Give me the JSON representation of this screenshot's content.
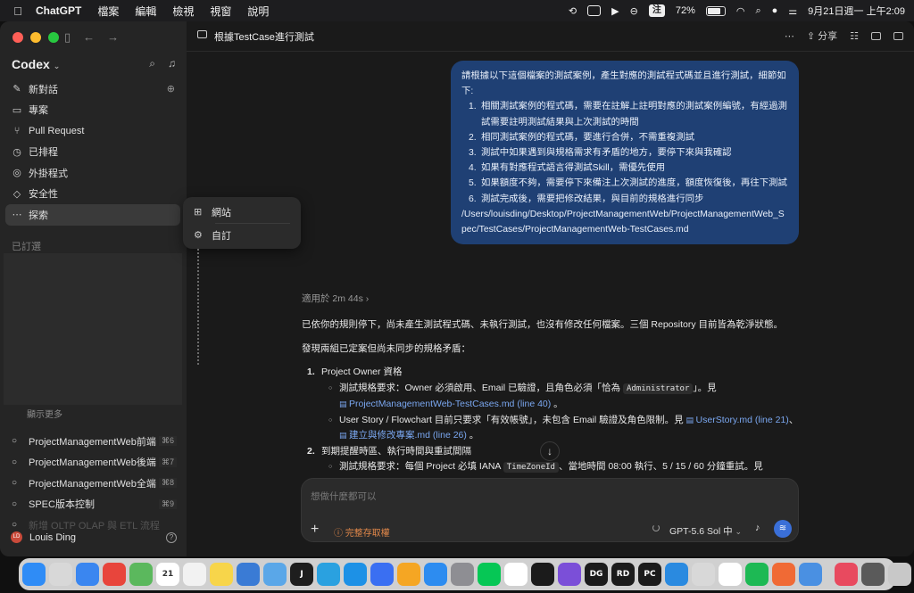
{
  "menubar": {
    "app": "ChatGPT",
    "menus": [
      "檔案",
      "編輯",
      "檢視",
      "視窗",
      "說明"
    ],
    "input_method": "注",
    "battery": "72%",
    "datetime": "9月21日週一 上午2:09"
  },
  "sidebar": {
    "brand": "Codex",
    "nav": [
      {
        "icon": "edit-icon",
        "glyph": "✎",
        "label": "新對話"
      },
      {
        "icon": "folder-icon",
        "glyph": "▭",
        "label": "專案"
      },
      {
        "icon": "pull-request-icon",
        "glyph": "⑂",
        "label": "Pull Request"
      },
      {
        "icon": "clock-icon",
        "glyph": "◷",
        "label": "已排程"
      },
      {
        "icon": "plugin-icon",
        "glyph": "◎",
        "label": "外掛程式"
      },
      {
        "icon": "shield-icon",
        "glyph": "◇",
        "label": "安全性"
      },
      {
        "icon": "more-icon",
        "glyph": "⋯",
        "label": "探索"
      }
    ],
    "pinned_label": "已訂選",
    "show_more": "顯示更多",
    "threads": [
      {
        "label": "ProjectManagementWeb前端",
        "shortcut": "⌘6"
      },
      {
        "label": "ProjectManagementWeb後端",
        "shortcut": "⌘7"
      },
      {
        "label": "ProjectManagementWeb全端",
        "shortcut": "⌘8"
      },
      {
        "label": "SPEC版本控制",
        "shortcut": "⌘9"
      },
      {
        "label": "新增 OLTP OLAP 與 ETL 流程",
        "shortcut": ""
      }
    ],
    "user": {
      "initials": "LD",
      "name": "Louis Ding"
    }
  },
  "popup": {
    "items": [
      {
        "icon": "website-icon",
        "glyph": "⊞",
        "label": "網站"
      },
      {
        "icon": "customize-icon",
        "glyph": "⚙",
        "label": "自訂"
      }
    ]
  },
  "main": {
    "title": "根據TestCase進行測試",
    "share_label": "分享",
    "user_message": {
      "intro": "請根據以下這個檔案的測試案例，產生對應的測試程式碼並且進行測試，細節如下:",
      "items": [
        {
          "n": "1.",
          "text": "相關測試案例的程式碼，需要在註解上註明對應的測試案例編號，有經過測試需要註明測試結果與上次測試的時間"
        },
        {
          "n": "2.",
          "text": "相同測試案例的程式碼，要進行合併，不需重複測試"
        },
        {
          "n": "3.",
          "text": "測試中如果遇到與規格需求有矛盾的地方，要停下來與我確認"
        },
        {
          "n": "4.",
          "text": "如果有對應程式語言得測試Skill，需優先使用"
        },
        {
          "n": "5.",
          "text": "如果額度不夠，需要停下來備注上次測試的進度，額度恢復後，再往下測試"
        },
        {
          "n": "6.",
          "text": "測試完成後，需要把修改結果，與目前的規格進行同步"
        }
      ],
      "path": "/Users/louisding/Desktop/ProjectManagementWeb/ProjectManagementWeb_Spec/TestCases/ProjectManagementWeb-TestCases.md"
    },
    "elapsed": "適用於 2m 44s",
    "response": {
      "p1": "已依你的規則停下，尚未產生測試程式碼、未執行測試，也沒有修改任何檔案。三個 Repository 目前皆為乾淨狀態。",
      "p2": "發現兩組已定案但尚未同步的規格矛盾：",
      "item1_title": "Project Owner 資格",
      "item1_sub1_a": "測試規格要求：Owner 必須啟用、Email 已驗證，且角色必須「恰為 ",
      "item1_sub1_code": "Administrator",
      "item1_sub1_b": "」。見",
      "item1_sub1_link": "ProjectManagementWeb-TestCases.md (line 40)",
      "item1_sub2_a": "User Story / Flowchart 目前只要求「有效帳號」，未包含 Email 驗證及角色限制。見 ",
      "item1_sub2_link1": "UserStory.md (line 21)",
      "item1_sub2_sep": "、",
      "item1_sub2_link2": "建立與修改專案.md (line 26)",
      "item2_title": "到期提醒時區、執行時間與重試間隔",
      "item2_sub1_a": "測試規格要求：每個 Project 必填 IANA ",
      "item2_sub1_code": "TimeZoneId",
      "item2_sub1_b": "、當地時間 08:00 執行、5 / 15 / 60 分鐘重試。見"
    },
    "composer": {
      "placeholder": "想做什麼都可以",
      "permission": "完整存取權",
      "model": "GPT-5.6 Sol 中"
    }
  },
  "dock": {
    "apps": [
      {
        "name": "finder-icon",
        "color": "#2f8cf6",
        "label": ""
      },
      {
        "name": "launchpad-icon",
        "color": "#d8d8d8",
        "label": ""
      },
      {
        "name": "mail-icon",
        "color": "#3a86f0",
        "label": ""
      },
      {
        "name": "chrome-icon",
        "color": "#e8453c",
        "label": ""
      },
      {
        "name": "maps-icon",
        "color": "#5bb85d",
        "label": ""
      },
      {
        "name": "calendar-icon",
        "color": "#ffffff",
        "label": "21"
      },
      {
        "name": "dots-icon",
        "color": "#f2f2f2",
        "label": ""
      },
      {
        "name": "notes-icon",
        "color": "#f7d54a",
        "label": ""
      },
      {
        "name": "freeform-icon",
        "color": "#3a7bd5",
        "label": ""
      },
      {
        "name": "home-icon",
        "color": "#5aa7e8",
        "label": ""
      },
      {
        "name": "jetbrains-icon",
        "color": "#1e1e1e",
        "label": "J"
      },
      {
        "name": "telegram-icon",
        "color": "#2aa1e0",
        "label": ""
      },
      {
        "name": "docker-icon",
        "color": "#1d91e6",
        "label": ""
      },
      {
        "name": "app-icon",
        "color": "#3a6ff2",
        "label": ""
      },
      {
        "name": "pencil-icon",
        "color": "#f5a623",
        "label": ""
      },
      {
        "name": "appstore-icon",
        "color": "#2d8cf0",
        "label": ""
      },
      {
        "name": "settings-icon",
        "color": "#8e8e93",
        "label": ""
      },
      {
        "name": "line-icon",
        "color": "#06c755",
        "label": ""
      },
      {
        "name": "code-icon",
        "color": "#ffffff",
        "label": ""
      },
      {
        "name": "terminal-icon",
        "color": "#1b1b1b",
        "label": ""
      },
      {
        "name": "obsidian-icon",
        "color": "#7b4fd8",
        "label": ""
      },
      {
        "name": "datagrip-icon",
        "color": "#1b1b1b",
        "label": "DG"
      },
      {
        "name": "rider-icon",
        "color": "#1b1b1b",
        "label": "RD"
      },
      {
        "name": "pycharm-icon",
        "color": "#1b1b1b",
        "label": "PC"
      },
      {
        "name": "vscode-icon",
        "color": "#2a8ae0",
        "label": ""
      },
      {
        "name": "preview-icon",
        "color": "#d8d8d8",
        "label": ""
      },
      {
        "name": "chatgpt-icon",
        "color": "#ffffff",
        "label": ""
      },
      {
        "name": "spotify-icon",
        "color": "#1db954",
        "label": ""
      },
      {
        "name": "brush-icon",
        "color": "#f06a35",
        "label": ""
      },
      {
        "name": "storage-icon",
        "color": "#4a90e2",
        "label": ""
      },
      {
        "name": "xcode-icon",
        "color": "#e84a5f",
        "label": ""
      },
      {
        "name": "downloads-icon",
        "color": "#5a5a5a",
        "label": ""
      },
      {
        "name": "trash-icon",
        "color": "#c8c8c8",
        "label": ""
      }
    ]
  }
}
